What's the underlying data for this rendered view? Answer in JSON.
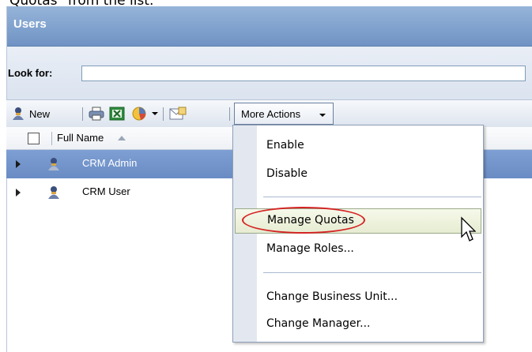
{
  "caption": "Quotas\" from the list.",
  "window": {
    "title": "Users"
  },
  "search": {
    "label": "Look for:",
    "value": ""
  },
  "toolbar": {
    "new_label": "New",
    "more_actions_label": "More Actions"
  },
  "grid": {
    "column_header": "Full Name",
    "rows": [
      {
        "name": "CRM Admin",
        "selected": true
      },
      {
        "name": "CRM User",
        "selected": false
      }
    ]
  },
  "more_actions_menu": {
    "items": [
      "Enable",
      "Disable",
      "Manage Quotas",
      "Manage Roles...",
      "Change Business Unit...",
      "Change Manager..."
    ],
    "hovered_item": "Manage Quotas"
  },
  "colors": {
    "header_blue": "#7a9bcc",
    "selected_row": "#7396cc",
    "highlight_oval": "#d52323",
    "menu_hover": "#eef2dc"
  },
  "icons": [
    "user-icon",
    "print-icon",
    "excel-export-icon",
    "chart-icon",
    "mail-merge-icon",
    "cursor-icon"
  ]
}
